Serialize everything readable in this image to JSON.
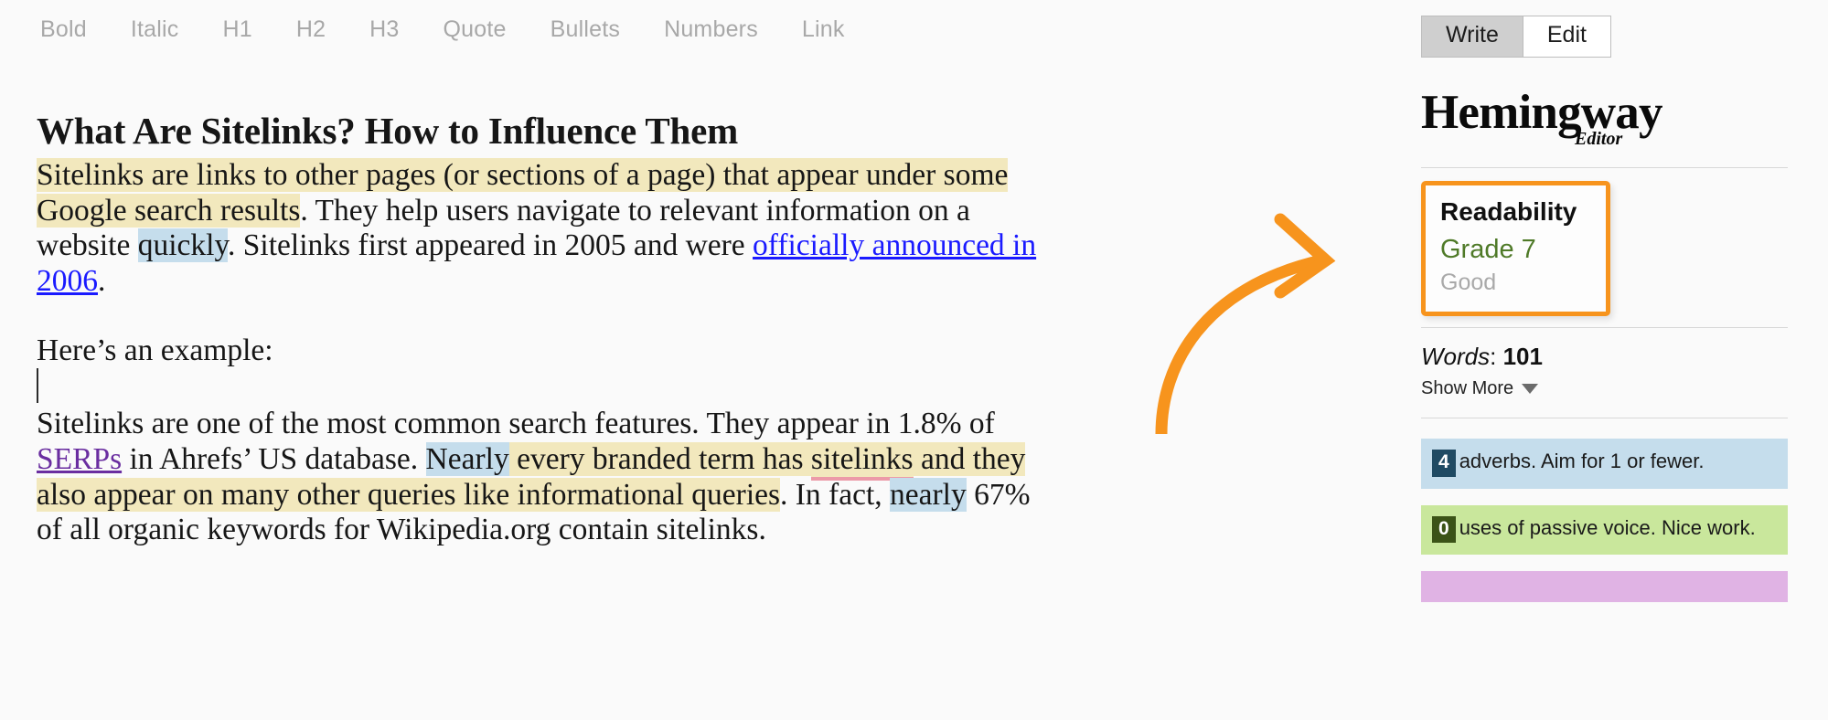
{
  "toolbar": {
    "items": [
      {
        "label": "Bold",
        "name": "bold"
      },
      {
        "label": "Italic",
        "name": "italic"
      },
      {
        "label": "H1",
        "name": "h1"
      },
      {
        "label": "H2",
        "name": "h2"
      },
      {
        "label": "H3",
        "name": "h3"
      },
      {
        "label": "Quote",
        "name": "quote"
      },
      {
        "label": "Bullets",
        "name": "bullets"
      },
      {
        "label": "Numbers",
        "name": "numbers"
      },
      {
        "label": "Link",
        "name": "link"
      }
    ]
  },
  "document": {
    "title": "What Are Sitelinks? How to Influence Them",
    "p1": {
      "hl1": "Sitelinks are links to other pages (or sections of a page) that appear under some Google search results",
      "t1": ". They help users navigate to relevant information on a website ",
      "hl2": "quickly",
      "t2": ". Sitelinks first appeared in 2005 and were ",
      "link": "officially announced in 2006",
      "t3": "."
    },
    "p2": "Here’s an example:",
    "p3": {
      "t1": "Sitelinks are one of the most common search features. They appear in 1.8% of ",
      "link": "SERPs",
      "t2": " in Ahrefs’ US database. ",
      "hl_blue1": "Nearly",
      "hl_yellow1": " every branded term has ",
      "hl_yellow_spell": "sitelinks",
      "hl_yellow2": " and they also appear on many other queries like informational queries",
      "t3": ". In fact, ",
      "hl_blue2": "nearly",
      "t4": " 67% of all organic keywords for Wikipedia.org contain sitelinks."
    }
  },
  "sidebar": {
    "mode": {
      "write": "Write",
      "edit": "Edit",
      "active": "Write"
    },
    "brand": {
      "name": "Hemingway",
      "sub": "Editor"
    },
    "readability": {
      "title": "Readability",
      "grade": "Grade 7",
      "label": "Good",
      "highlight_color": "#f7941d",
      "grade_color": "#4f7a28"
    },
    "words": {
      "label": "Words",
      "separator": ":",
      "count": "101"
    },
    "show_more": "Show More",
    "stats": [
      {
        "name": "adverbs",
        "count": "4",
        "text": "adverbs. Aim for 1 or fewer.",
        "bg": "#c5ddec",
        "badge_bg": "#1f4a63"
      },
      {
        "name": "passive-voice",
        "count": "0",
        "text": "uses of passive voice. Nice work.",
        "bg": "#c9e79c",
        "badge_bg": "#3b5317"
      },
      {
        "name": "complex-phrases",
        "count": "",
        "text": "",
        "bg": "#e0b3e4",
        "badge_bg": "#6d2f73"
      }
    ]
  },
  "annotation": {
    "arrow_color": "#f7941d",
    "points_to": "Readability"
  }
}
